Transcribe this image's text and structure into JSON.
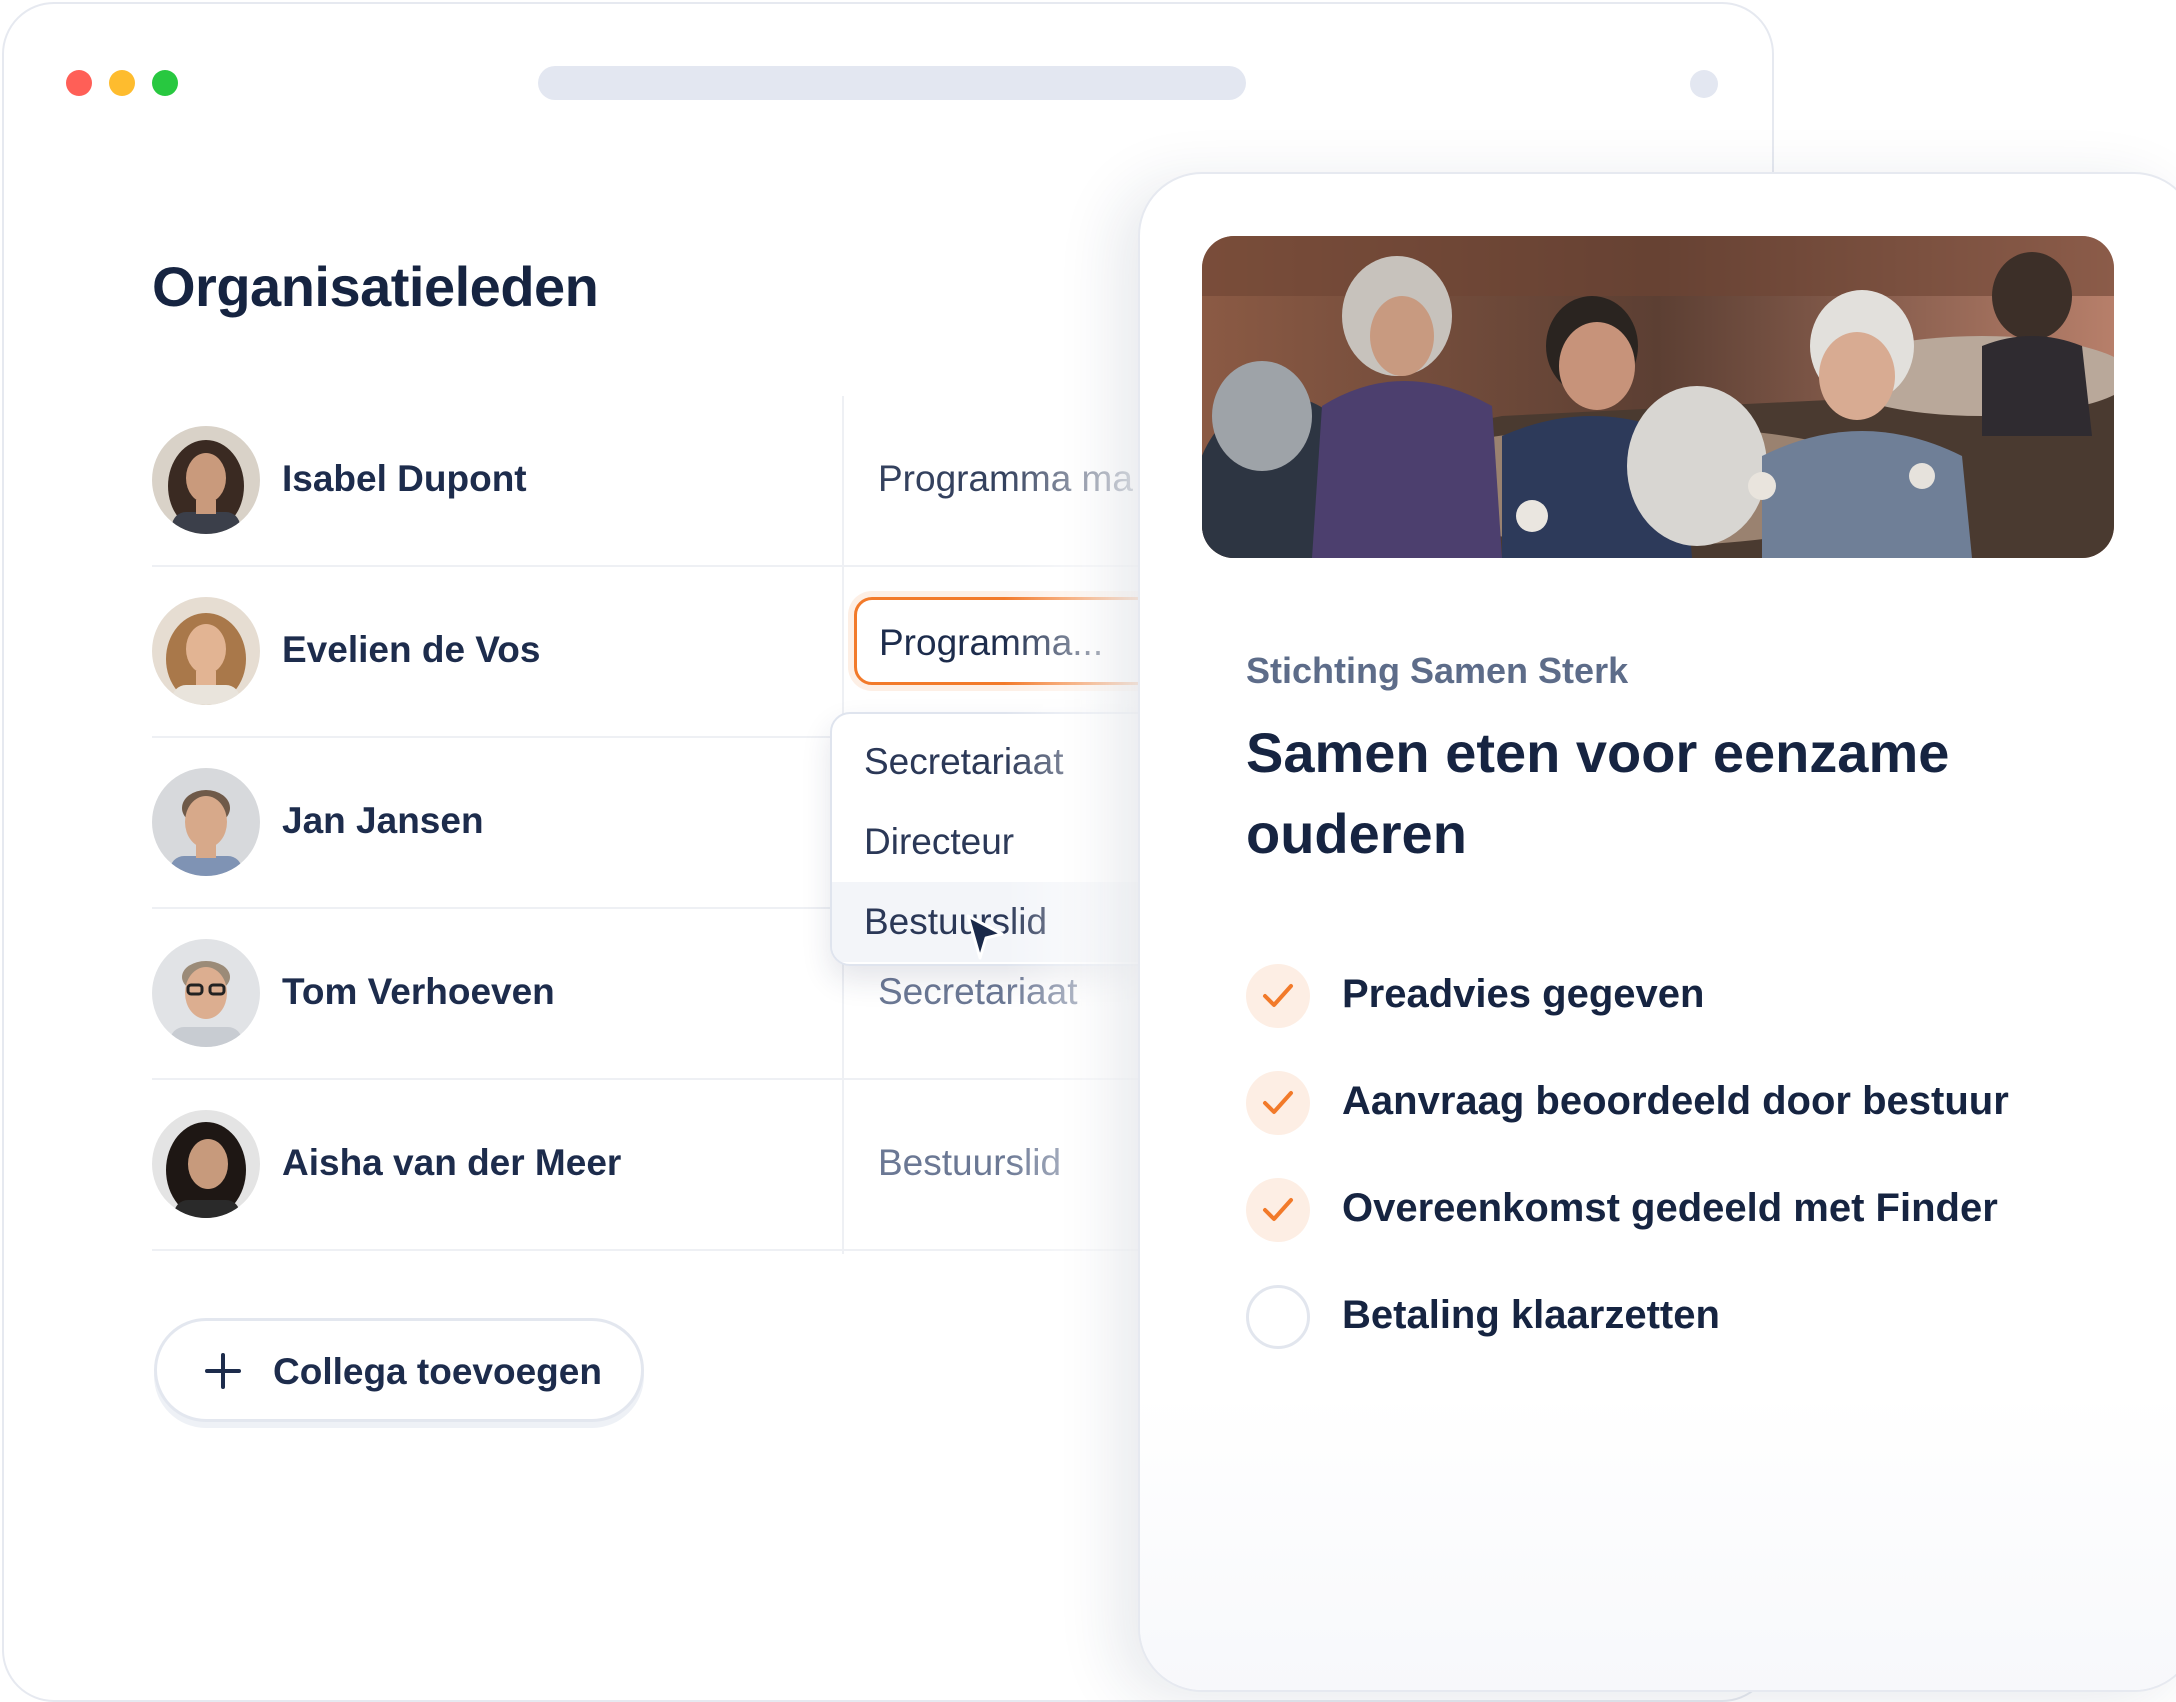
{
  "members_panel": {
    "title": "Organisatieleden",
    "members": [
      {
        "name": "Isabel Dupont",
        "role": "Programma ma"
      },
      {
        "name": "Evelien de Vos",
        "role": "Programma..."
      },
      {
        "name": "Jan Jansen",
        "role": ""
      },
      {
        "name": "Tom Verhoeven",
        "role": "Secretariaat"
      },
      {
        "name": "Aisha van der Meer",
        "role": "Bestuurslid"
      }
    ],
    "role_dropdown": {
      "options": [
        "Secretariaat",
        "Directeur",
        "Bestuurslid"
      ],
      "hovered": "Bestuurslid"
    },
    "add_button_label": "Collega toevoegen"
  },
  "project_card": {
    "organization": "Stichting Samen Sterk",
    "title": "Samen eten voor eenzame ouderen",
    "steps": [
      {
        "label": "Preadvies gegeven",
        "done": true
      },
      {
        "label": "Aanvraag beoordeeld door bestuur",
        "done": true
      },
      {
        "label": "Overeenkomst gedeeld met Finder",
        "done": true
      },
      {
        "label": "Betaling klaarzetten",
        "done": false
      }
    ]
  },
  "colors": {
    "accent": "#f27a2a",
    "check_bg": "#fdeee4",
    "heading": "#162441",
    "muted": "#6b7894"
  },
  "icons": [
    "plus-icon",
    "check-icon",
    "cursor-icon"
  ]
}
